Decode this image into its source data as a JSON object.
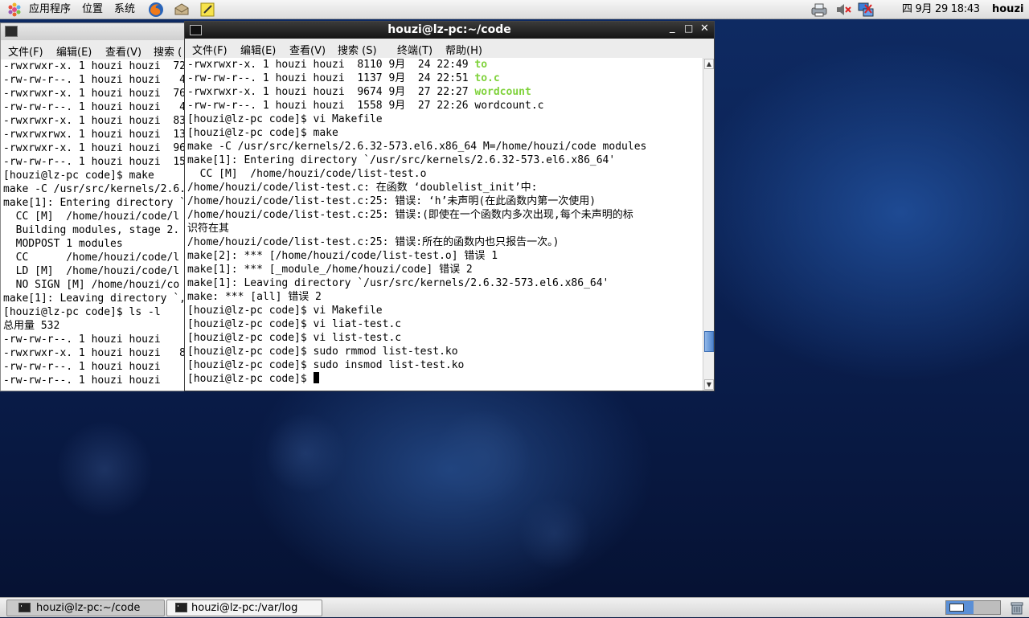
{
  "top_panel": {
    "menu_apps": "应用程序",
    "menu_places": "位置",
    "menu_system": "系统",
    "app_icons": [
      "firefox-icon",
      "mail-icon",
      "notes-icon"
    ],
    "tray_icons": [
      "network-printer-icon",
      "volume-muted-icon",
      "network-icon"
    ],
    "clock": "四 9月 29 18:43",
    "user": "houzi"
  },
  "back_window": {
    "title": "houzi@lz-pc:/var/log",
    "menu": [
      "文件(F)",
      "编辑(E)",
      "查看(V)",
      "搜索 ("
    ],
    "lines": [
      "-rwxrwxr-x. 1 houzi houzi  72",
      "-rw-rw-r--. 1 houzi houzi   4",
      "-rwxrwxr-x. 1 houzi houzi  76",
      "-rw-rw-r--. 1 houzi houzi   4",
      "-rwxrwxr-x. 1 houzi houzi  83",
      "-rwxrwxrwx. 1 houzi houzi  13",
      "-rwxrwxr-x. 1 houzi houzi  96",
      "-rw-rw-r--. 1 houzi houzi  15",
      "[houzi@lz-pc code]$ make",
      "make -C /usr/src/kernels/2.6.",
      "make[1]: Entering directory `",
      "  CC [M]  /home/houzi/code/l",
      "  Building modules, stage 2.",
      "  MODPOST 1 modules",
      "  CC      /home/houzi/code/l",
      "  LD [M]  /home/houzi/code/l",
      "  NO SIGN [M] /home/houzi/co",
      "make[1]: Leaving directory `,",
      "[houzi@lz-pc code]$ ls -l",
      "总用量 532",
      "-rw-rw-r--. 1 houzi houzi   ",
      "-rwxrwxr-x. 1 houzi houzi   8",
      "-rw-rw-r--. 1 houzi houzi   ",
      "-rw-rw-r--. 1 houzi houzi   "
    ]
  },
  "front_window": {
    "title": "houzi@lz-pc:~/code",
    "controls": [
      "_",
      "□",
      "✕"
    ],
    "menu": [
      "文件(F)",
      "编辑(E)",
      "查看(V)",
      "搜索 (S)",
      "终端(T)",
      "帮助(H)"
    ],
    "lines": [
      {
        "pre": "-rwxrwxr-x. 1 houzi houzi  8110 9月  24 22:49 ",
        "hl": "to"
      },
      {
        "pre": "-rw-rw-r--. 1 houzi houzi  1137 9月  24 22:51 ",
        "hl": "to.c"
      },
      {
        "pre": "-rwxrwxr-x. 1 houzi houzi  9674 9月  27 22:27 ",
        "hl": "wordcount"
      },
      {
        "pre": "-rw-rw-r--. 1 houzi houzi  1558 9月  27 22:26 wordcount.c",
        "hl": ""
      },
      {
        "pre": "[houzi@lz-pc code]$ vi Makefile",
        "hl": ""
      },
      {
        "pre": "[houzi@lz-pc code]$ make",
        "hl": ""
      },
      {
        "pre": "make -C /usr/src/kernels/2.6.32-573.el6.x86_64 M=/home/houzi/code modules",
        "hl": ""
      },
      {
        "pre": "make[1]: Entering directory `/usr/src/kernels/2.6.32-573.el6.x86_64'",
        "hl": ""
      },
      {
        "pre": "  CC [M]  /home/houzi/code/list-test.o",
        "hl": ""
      },
      {
        "pre": "/home/houzi/code/list-test.c: 在函数 ‘doublelist_init’中:",
        "hl": ""
      },
      {
        "pre": "/home/houzi/code/list-test.c:25: 错误: ‘h’未声明(在此函数内第一次使用)",
        "hl": ""
      },
      {
        "pre": "/home/houzi/code/list-test.c:25: 错误:(即使在一个函数内多次出现,每个未声明的标",
        "hl": ""
      },
      {
        "pre": "识符在其",
        "hl": ""
      },
      {
        "pre": "/home/houzi/code/list-test.c:25: 错误:所在的函数内也只报告一次。)",
        "hl": ""
      },
      {
        "pre": "make[2]: *** [/home/houzi/code/list-test.o] 错误 1",
        "hl": ""
      },
      {
        "pre": "make[1]: *** [_module_/home/houzi/code] 错误 2",
        "hl": ""
      },
      {
        "pre": "make[1]: Leaving directory `/usr/src/kernels/2.6.32-573.el6.x86_64'",
        "hl": ""
      },
      {
        "pre": "make: *** [all] 错误 2",
        "hl": ""
      },
      {
        "pre": "[houzi@lz-pc code]$ vi Makefile",
        "hl": ""
      },
      {
        "pre": "[houzi@lz-pc code]$ vi liat-test.c",
        "hl": ""
      },
      {
        "pre": "[houzi@lz-pc code]$ vi list-test.c",
        "hl": ""
      },
      {
        "pre": "[houzi@lz-pc code]$ sudo rmmod list-test.ko",
        "hl": ""
      },
      {
        "pre": "[houzi@lz-pc code]$ sudo insmod list-test.ko",
        "hl": ""
      },
      {
        "pre": "[houzi@lz-pc code]$ ",
        "hl": ""
      }
    ],
    "scroll_fraction": 0.9
  },
  "taskbar": {
    "tasks": [
      "houzi@lz-pc:~/code",
      "houzi@lz-pc:/var/log"
    ],
    "workspace_icons": [
      "workspace-switcher-icon",
      "trash-icon"
    ]
  },
  "colors": {
    "highlight_green": "#7fd23b",
    "titlebar_active": "#1f1f1f",
    "desktop_blue": "#0e2a62"
  }
}
